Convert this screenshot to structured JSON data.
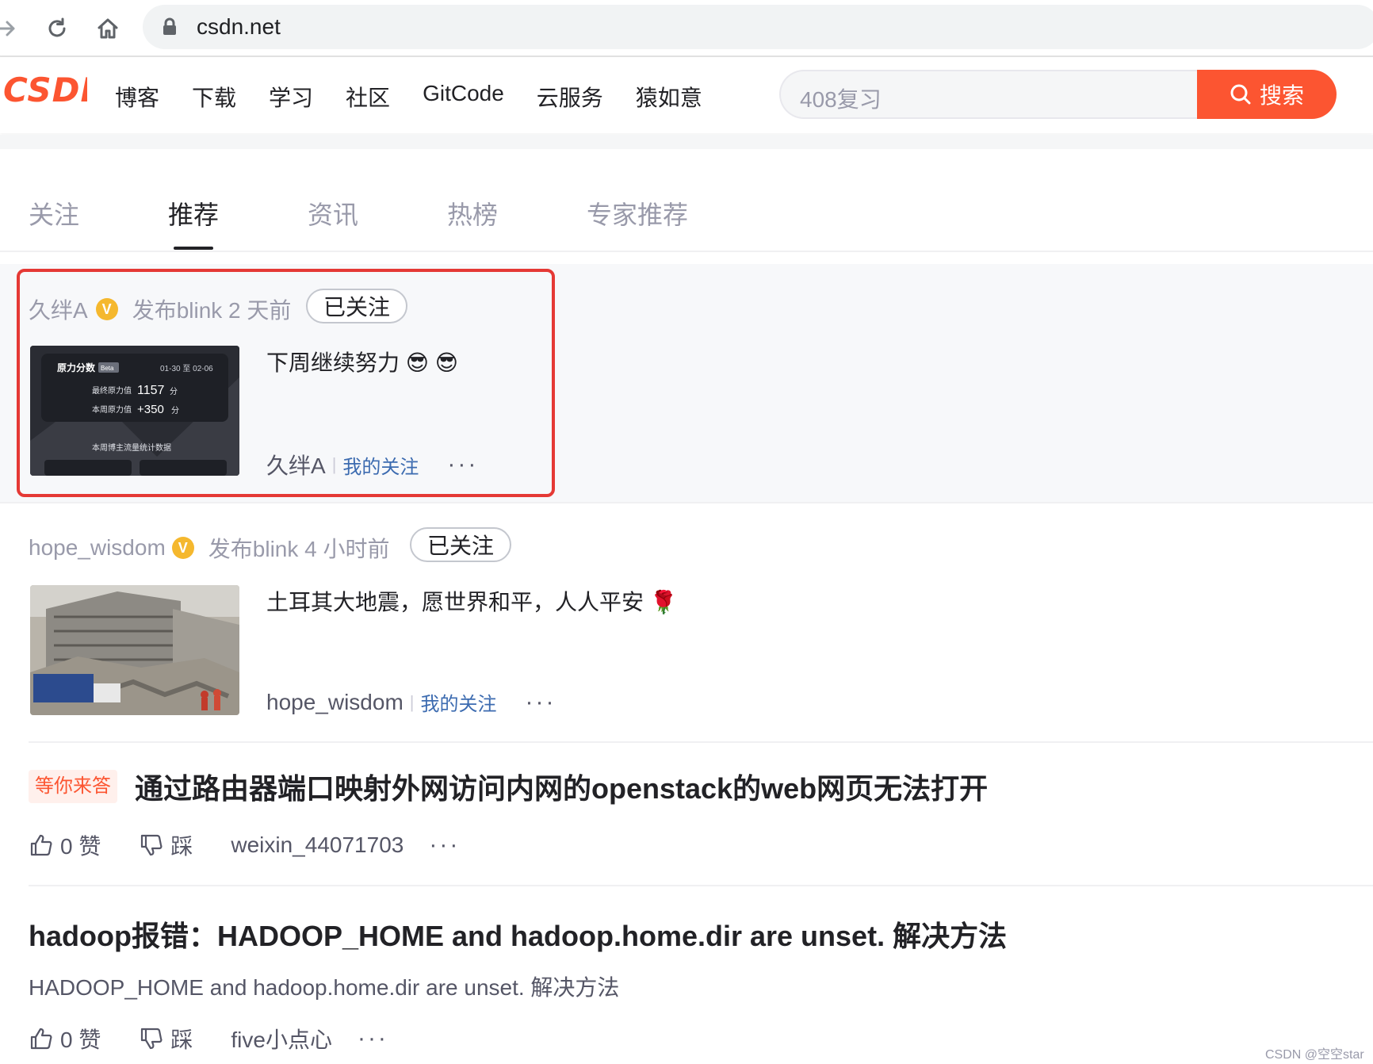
{
  "browser": {
    "url": "csdn.net"
  },
  "header": {
    "logo": "CSDN",
    "nav": [
      "博客",
      "下载",
      "学习",
      "社区",
      "GitCode",
      "云服务",
      "猿如意"
    ],
    "search_placeholder": "408复习",
    "search_button": "搜索"
  },
  "tabs": [
    "关注",
    "推荐",
    "资讯",
    "热榜",
    "专家推荐"
  ],
  "active_tab": "推荐",
  "feed": {
    "blink1": {
      "user": "久绊A",
      "badge": "V",
      "action": "发布blink 2 天前",
      "follow": "已关注",
      "text": "下周继续努力 😎 😎",
      "thumb": {
        "title": "原力分数",
        "beta": "Beta",
        "date": "01-30 至 02-06",
        "line1_label": "最终原力值",
        "line1_value": "1157",
        "line1_unit": "分",
        "line2_label": "本周原力值",
        "line2_value": "+350",
        "line2_unit": "分",
        "footer": "本周博主流量统计数据"
      },
      "author": "久绊A",
      "my_follow": "我的关注",
      "more": "···"
    },
    "blink2": {
      "user": "hope_wisdom",
      "badge": "V",
      "action": "发布blink 4 小时前",
      "follow": "已关注",
      "text": "土耳其大地震，愿世界和平，人人平安 🌹",
      "author": "hope_wisdom",
      "my_follow": "我的关注",
      "more": "···"
    },
    "question": {
      "tag": "等你来答",
      "title": "通过路由器端口映射外网访问内网的openstack的web网页无法打开",
      "likes": "0 赞",
      "dislike": "踩",
      "author": "weixin_44071703",
      "more": "···"
    },
    "article": {
      "title": "hadoop报错：HADOOP_HOME and hadoop.home.dir are unset. 解决方法",
      "summary": "HADOOP_HOME and hadoop.home.dir are unset. 解决方法",
      "likes": "0 赞",
      "dislike": "踩",
      "author": "five小点心",
      "more": "···"
    }
  },
  "watermark": "CSDN @空空star",
  "colors": {
    "brand": "#fc5531",
    "highlight": "#e53935",
    "link": "#3c6bb0",
    "badge": "#f5b82e"
  }
}
